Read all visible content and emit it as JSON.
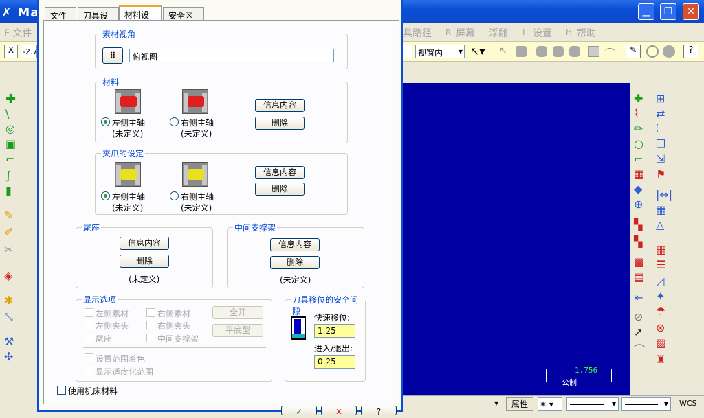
{
  "app": {
    "title": "Mas"
  },
  "menu": {
    "file": "F 文件",
    "toolpath": "具路径",
    "screen_key": "R",
    "screen": "屏幕",
    "float": "浮雕",
    "settings_key": "I",
    "settings": "设置",
    "help_key": "H",
    "help": "帮助"
  },
  "toolbar": {
    "x_label": "X",
    "x_value": "-2.7",
    "view_select": "视窗内"
  },
  "dialog": {
    "tabs": [
      "文件",
      "刀具设置",
      "材料设置",
      "安全区域"
    ],
    "stock_view": {
      "title": "素材视角",
      "value": "俯视图"
    },
    "stock": {
      "title": "材料",
      "left": "左侧主轴",
      "right": "右侧主轴",
      "left_state": "(未定义)",
      "right_state": "(未定义)",
      "info": "信息内容",
      "delete": "删除"
    },
    "chuck": {
      "title": "夹爪的设定",
      "left": "左侧主轴",
      "right": "右侧主轴",
      "left_state": "(未定义)",
      "right_state": "(未定义)",
      "info": "信息内容",
      "delete": "删除"
    },
    "tailstock": {
      "title": "尾座",
      "info": "信息内容",
      "delete": "删除",
      "state": "(未定义)"
    },
    "steady_rest": {
      "title": "中间支撑架",
      "info": "信息内容",
      "delete": "删除",
      "state": "(未定义)"
    },
    "display": {
      "title": "显示选项",
      "left_stock": "左侧素材",
      "right_stock": "右侧素材",
      "left_chuck": "左侧夹头",
      "right_chuck": "右侧夹头",
      "tailstock": "尾座",
      "steady": "中间支撑架",
      "all_on": "全开",
      "flat": "平底型",
      "shade_range": "设置范围着色",
      "fit_range": "显示适度化范围"
    },
    "clearance": {
      "title": "刀具移位的安全间隙",
      "rapid_label": "快速移位:",
      "rapid_value": "1.25",
      "entry_label": "进入/退出:",
      "entry_value": "0.25"
    },
    "use_machine_stock": "使用机床材料"
  },
  "viewport": {
    "scale_value": "1.756",
    "scale_unit": "公制"
  },
  "status": {
    "attributes": "属性",
    "wcs": "WCS"
  },
  "colors": {
    "title_bar": "#0a4fd6",
    "viewport": "#0000a2",
    "highlight_input": "#ffff99",
    "stock_red": "#e02020",
    "chuck_yellow": "#e8e020"
  }
}
